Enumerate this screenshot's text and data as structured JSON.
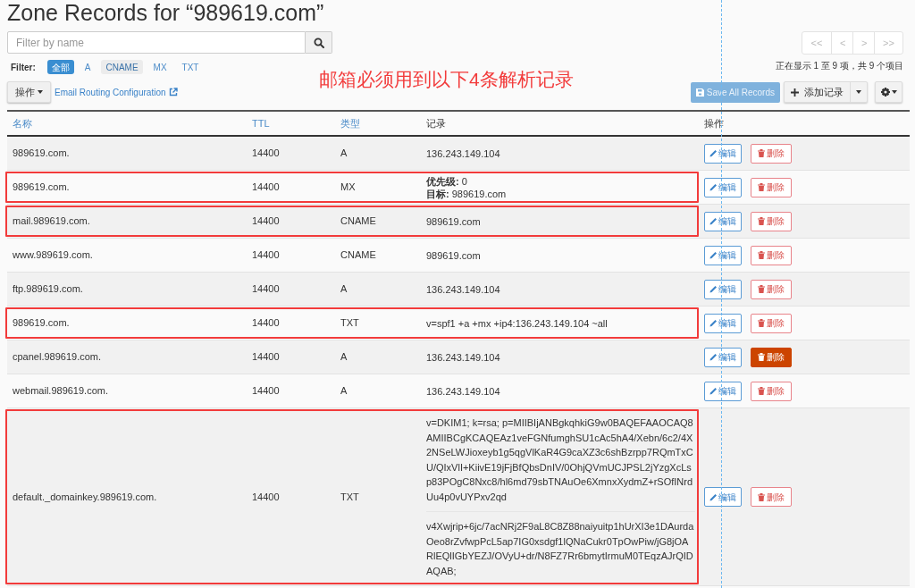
{
  "title": "Zone Records for “989619.com”",
  "search": {
    "placeholder": "Filter by name"
  },
  "filter": {
    "label": "Filter:",
    "options": [
      {
        "label": "全部",
        "selected": true,
        "hover": false
      },
      {
        "label": "A",
        "selected": false,
        "hover": false
      },
      {
        "label": "CNAME",
        "selected": false,
        "hover": true
      },
      {
        "label": "MX",
        "selected": false,
        "hover": false
      },
      {
        "label": "TXT",
        "selected": false,
        "hover": false
      }
    ]
  },
  "annotation": "邮箱必须用到以下4条解析记录",
  "pagination": {
    "buttons": [
      "<<",
      "<",
      ">",
      ">>"
    ],
    "summary": "正在显示 1 至 9 项，共 9 个项目"
  },
  "actions_button": "操作",
  "email_routing_link": "Email Routing Configuration",
  "save_button": {
    "label": "Save All Records",
    "disabled": true
  },
  "add_button": "添加记录",
  "table": {
    "columns": [
      {
        "label": "名称",
        "sortable": true
      },
      {
        "label": "TTL",
        "sortable": true
      },
      {
        "label": "类型",
        "sortable": true
      },
      {
        "label": "记录",
        "sortable": false
      },
      {
        "label": "操作",
        "sortable": false
      }
    ],
    "rows": [
      {
        "name": "989619.com.",
        "ttl": "14400",
        "type": "A",
        "record": [
          "136.243.149.104"
        ],
        "highlighted": false,
        "edit": "编辑",
        "delete": "删除",
        "delete_hover": false
      },
      {
        "name": "989619.com.",
        "ttl": "14400",
        "type": "MX",
        "record": [
          "**优先级:** 0",
          "**目标:** 989619.com"
        ],
        "highlighted": true,
        "edit": "编辑",
        "delete": "删除",
        "delete_hover": false
      },
      {
        "name": "mail.989619.com.",
        "ttl": "14400",
        "type": "CNAME",
        "record": [
          "989619.com"
        ],
        "highlighted": true,
        "edit": "编辑",
        "delete": "删除",
        "delete_hover": false
      },
      {
        "name": "www.989619.com.",
        "ttl": "14400",
        "type": "CNAME",
        "record": [
          "989619.com"
        ],
        "highlighted": false,
        "edit": "编辑",
        "delete": "删除",
        "delete_hover": false
      },
      {
        "name": "ftp.989619.com.",
        "ttl": "14400",
        "type": "A",
        "record": [
          "136.243.149.104"
        ],
        "highlighted": false,
        "edit": "编辑",
        "delete": "删除",
        "delete_hover": false
      },
      {
        "name": "989619.com.",
        "ttl": "14400",
        "type": "TXT",
        "record": [
          "v=spf1 +a +mx +ip4:136.243.149.104 ~all"
        ],
        "highlighted": true,
        "edit": "编辑",
        "delete": "删除",
        "delete_hover": false
      },
      {
        "name": "cpanel.989619.com.",
        "ttl": "14400",
        "type": "A",
        "record": [
          "136.243.149.104"
        ],
        "highlighted": false,
        "edit": "编辑",
        "delete": "删除",
        "delete_hover": true
      },
      {
        "name": "webmail.989619.com.",
        "ttl": "14400",
        "type": "A",
        "record": [
          "136.243.149.104"
        ],
        "highlighted": false,
        "edit": "编辑",
        "delete": "删除",
        "delete_hover": false
      },
      {
        "name": "default._domainkey.989619.com.",
        "ttl": "14400",
        "type": "TXT",
        "record_parts": [
          "v=DKIM1; k=rsa; p=MIIBIjANBgkqhkiG9w0BAQEFAAOCAQ8AMIIBCgKCAQEAz1veFGNfumghSU1cAc5hA4/Xebn/6c2/4X2NSeLWJioxeyb1g5qgVlKaR4G9caXZ3c6shBzrpp7RQmTxCU/QIxVlI+KiivE19jFjBfQbsDnIV/0OhjQVmUCJPSL2jYzgXcLsp83POgC8Nxc8/hl6md79sbTNAuOe6XmnxXydmZ+rSOfINrdUu4p0vUYPxv2qd",
          "v4Xwjrip+6jc/7acNRj2F9aL8C8Z88naiyuitp1hUrXI3e1DAurdaOeo8rZvfwpPcL5ap7IG0xsdgf1lQNaCukr0TpOwPiw/jG8jOARlEQlIGbYEZJ/OVyU+dr/N8FZ7Rr6bmytIrmuM0TEqzAJrQIDAQAB;"
        ],
        "highlighted": true,
        "edit": "编辑",
        "delete": "删除",
        "delete_hover": false
      }
    ]
  }
}
